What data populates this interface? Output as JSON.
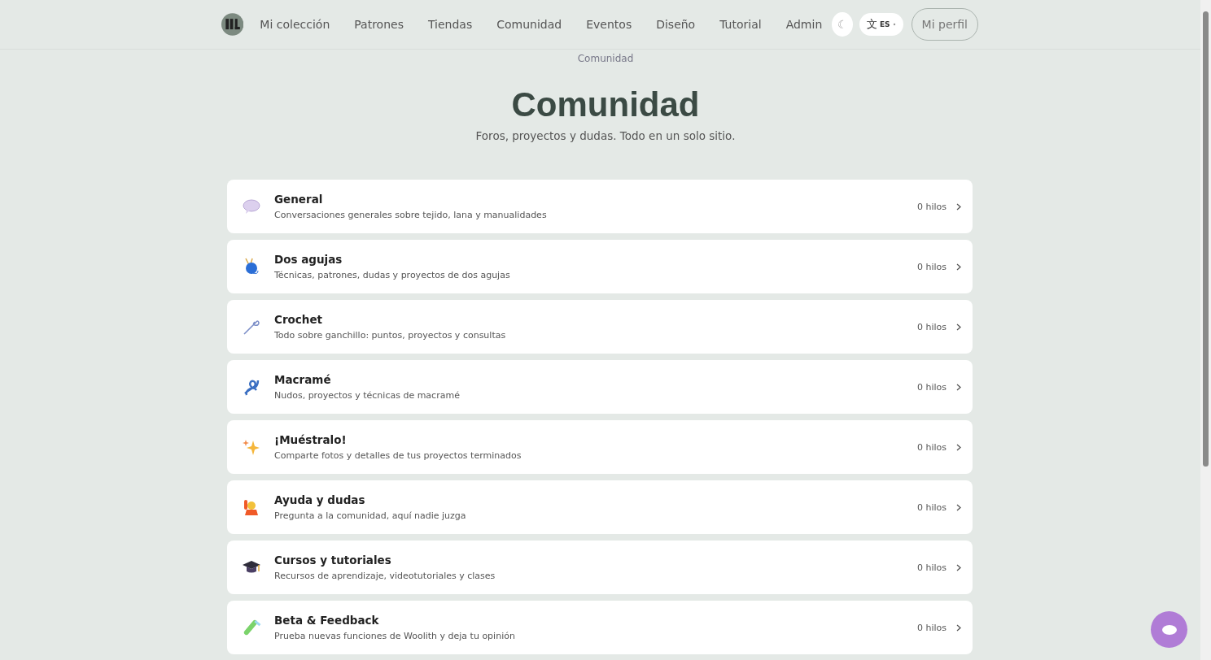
{
  "nav": {
    "items": [
      {
        "label": "Mi colección",
        "selected": false
      },
      {
        "label": "Patrones",
        "selected": false
      },
      {
        "label": "Tiendas",
        "selected": false
      },
      {
        "label": "Comunidad",
        "selected": false
      },
      {
        "label": "Eventos",
        "selected": false
      },
      {
        "label": "Diseño",
        "selected": false
      },
      {
        "label": "Tutorial",
        "selected": false
      },
      {
        "label": "Admin",
        "selected": false
      }
    ],
    "theme_toggle": "☾",
    "language": {
      "glyph": "文",
      "code": "ES"
    },
    "profile": "Mi perfil"
  },
  "breadcrumb": "Comunidad",
  "title": "Comunidad",
  "subtitle": "Foros, proyectos y dudas. Todo en un solo sitio.",
  "forums": [
    {
      "name": "General",
      "description": "Conversaciones generales sobre tejido, lana y manualidades",
      "count": "0 hilos"
    },
    {
      "name": "Dos agujas",
      "description": "Técnicas, patrones, dudas y proyectos de dos agujas",
      "count": "0 hilos"
    },
    {
      "name": "Crochet",
      "description": "Todo sobre ganchillo: puntos, proyectos y consultas",
      "count": "0 hilos"
    },
    {
      "name": "Macramé",
      "description": "Nudos, proyectos y técnicas de macramé",
      "count": "0 hilos"
    },
    {
      "name": "¡Muéstralo!",
      "description": "Comparte fotos y detalles de tus proyectos terminados",
      "count": "0 hilos"
    },
    {
      "name": "Ayuda y dudas",
      "description": "Pregunta a la comunidad, aquí nadie juzga",
      "count": "0 hilos"
    },
    {
      "name": "Cursos y tutoriales",
      "description": "Recursos de aprendizaje, videotutoriales y clases",
      "count": "0 hilos"
    },
    {
      "name": "Beta & Feedback",
      "description": "Prueba nuevas funciones de Woolith y deja tu opinión",
      "count": "0 hilos"
    }
  ]
}
